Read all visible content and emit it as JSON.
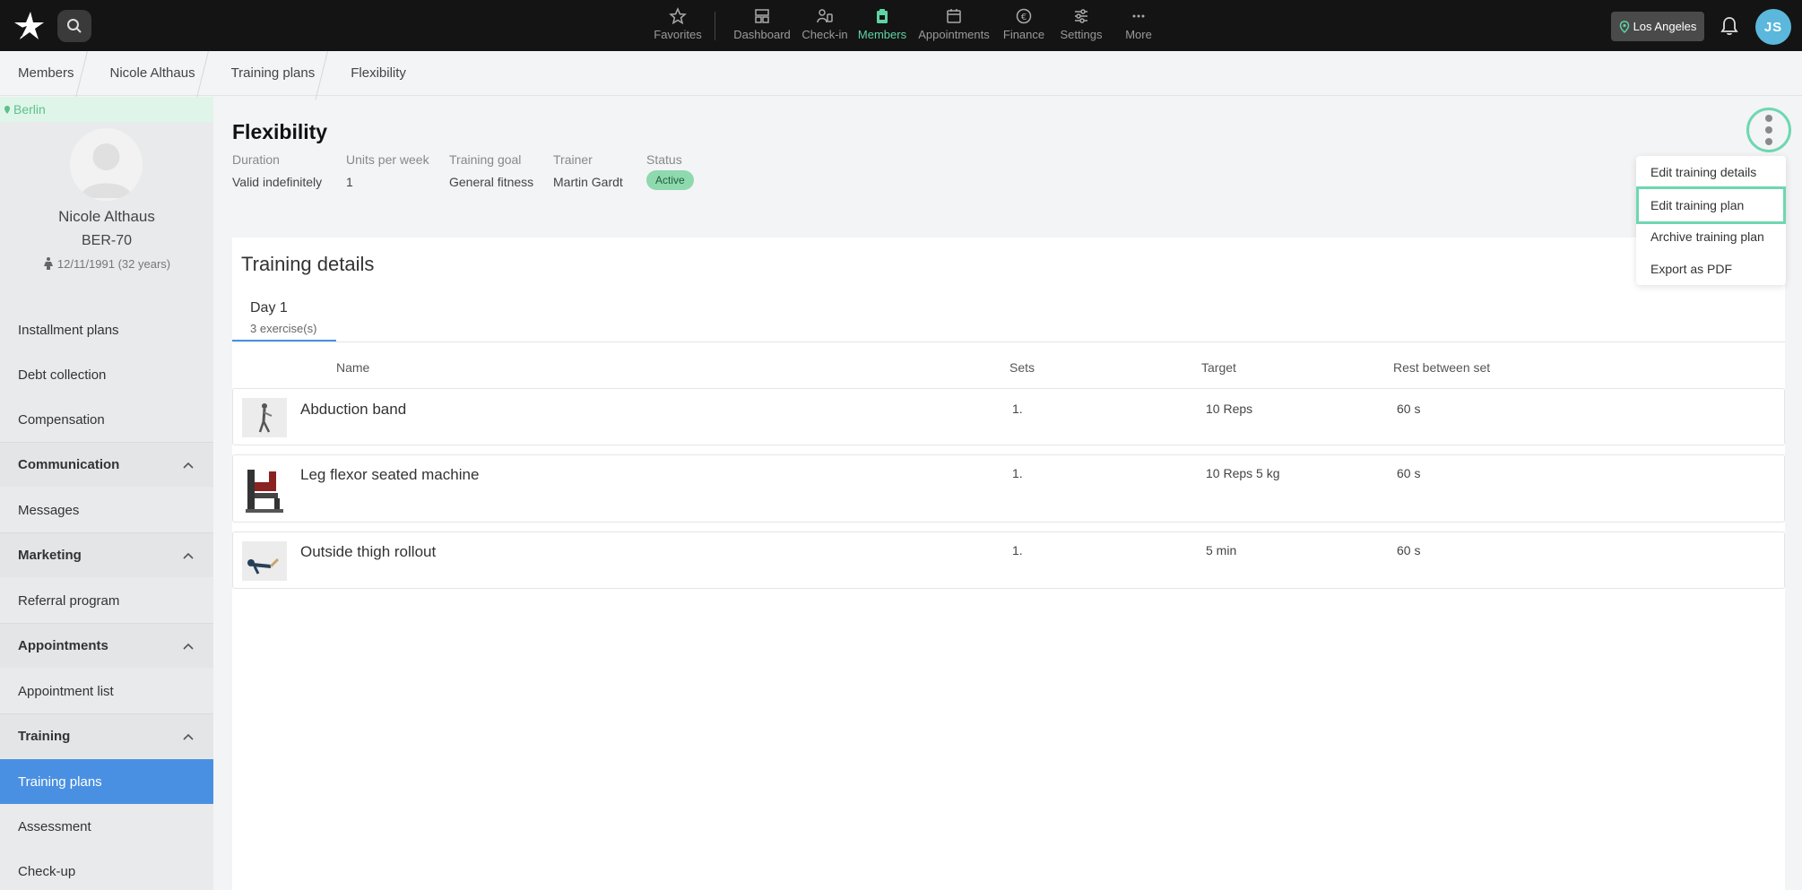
{
  "topbar": {
    "nav": [
      {
        "label": "Favorites",
        "icon": "star-icon"
      },
      {
        "label": "Dashboard",
        "icon": "dashboard-icon"
      },
      {
        "label": "Check-in",
        "icon": "check-in-icon"
      },
      {
        "label": "Members",
        "icon": "members-icon"
      },
      {
        "label": "Appointments",
        "icon": "calendar-icon"
      },
      {
        "label": "Finance",
        "icon": "euro-icon"
      },
      {
        "label": "Settings",
        "icon": "sliders-icon"
      },
      {
        "label": "More",
        "icon": "more-icon"
      }
    ],
    "active_nav": "Members",
    "location": "Los Angeles",
    "user_initials": "JS"
  },
  "breadcrumb": [
    "Members",
    "Nicole Althaus",
    "Training plans",
    "Flexibility"
  ],
  "sidebar": {
    "location": "Berlin",
    "member_name": "Nicole Althaus",
    "member_id": "BER-70",
    "dob": "12/11/1991 (32 years)",
    "items": [
      {
        "label": "Installment plans"
      },
      {
        "label": "Debt collection"
      },
      {
        "label": "Compensation"
      },
      {
        "label": "Communication"
      },
      {
        "label": "Messages"
      },
      {
        "label": "Marketing"
      },
      {
        "label": "Referral program"
      },
      {
        "label": "Appointments"
      },
      {
        "label": "Appointment list"
      },
      {
        "label": "Training"
      },
      {
        "label": "Training plans"
      },
      {
        "label": "Assessment"
      },
      {
        "label": "Check-up"
      }
    ]
  },
  "plan": {
    "title": "Flexibility",
    "meta": [
      {
        "label": "Duration",
        "value": "Valid indefinitely"
      },
      {
        "label": "Units per week",
        "value": "1"
      },
      {
        "label": "Training goal",
        "value": "General fitness"
      },
      {
        "label": "Trainer",
        "value": "Martin Gardt"
      },
      {
        "label": "Status",
        "value": "Active"
      }
    ]
  },
  "details": {
    "title": "Training details",
    "day_tab": {
      "label": "Day 1",
      "sub": "3 exercise(s)"
    },
    "columns": [
      "Name",
      "Sets",
      "Target",
      "Rest between set"
    ],
    "rows": [
      {
        "name": "Abduction band",
        "sets": "1.",
        "target": "10 Reps",
        "rest": "60 s"
      },
      {
        "name": "Leg flexor seated machine",
        "sets": "1.",
        "target": "10 Reps 5 kg",
        "rest": "60 s"
      },
      {
        "name": "Outside thigh rollout",
        "sets": "1.",
        "target": "5 min",
        "rest": "60 s"
      }
    ]
  },
  "menu": {
    "items": [
      "Edit training details",
      "Edit training plan",
      "Archive training plan",
      "Export as PDF"
    ],
    "highlighted": "Edit training plan"
  },
  "colors": {
    "accent": "#5fd3a4",
    "active_sidebar": "#4a90e2",
    "badge": "#8fd9ae"
  }
}
